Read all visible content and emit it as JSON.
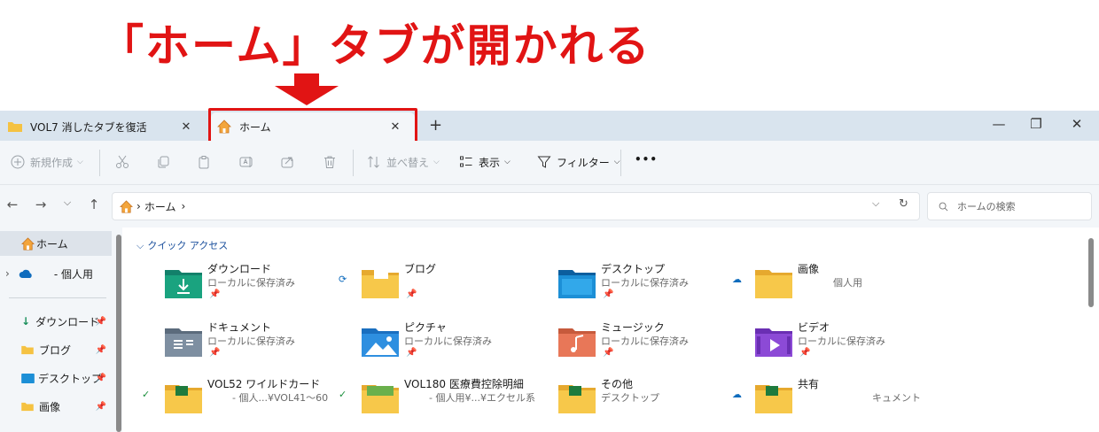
{
  "annotation": {
    "title": "「ホーム」タブが開かれる"
  },
  "tabs": {
    "inactive_label": "VOL7 消したタブを復活",
    "active_label": "ホーム",
    "close_glyph": "✕",
    "add_glyph": "+"
  },
  "window_controls": {
    "minimize": "—",
    "restore": "❐",
    "close": "✕"
  },
  "toolbar": {
    "new_label": "新規作成",
    "sort_label": "並べ替え",
    "view_label": "表示",
    "filter_label": "フィルター",
    "more_label": "•••"
  },
  "address": {
    "path_label": "ホーム",
    "search_placeholder": "ホームの検索"
  },
  "sidebar": {
    "items": [
      {
        "label": "ホーム"
      },
      {
        "label": "- 個人用"
      },
      {
        "label": "ダウンロード"
      },
      {
        "label": "ブログ"
      },
      {
        "label": "デスクトップ"
      },
      {
        "label": "画像"
      }
    ]
  },
  "quick_access": {
    "heading": "クイック アクセス",
    "tiles": [
      {
        "name": "ダウンロード",
        "sub": "ローカルに保存済み"
      },
      {
        "name": "ブログ",
        "sub": ""
      },
      {
        "name": "デスクトップ",
        "sub": "ローカルに保存済み"
      },
      {
        "name": "画像",
        "sub": "個人用"
      },
      {
        "name": "ドキュメント",
        "sub": "ローカルに保存済み"
      },
      {
        "name": "ピクチャ",
        "sub": "ローカルに保存済み"
      },
      {
        "name": "ミュージック",
        "sub": "ローカルに保存済み"
      },
      {
        "name": "ビデオ",
        "sub": "ローカルに保存済み"
      },
      {
        "name": "VOL52 ワイルドカード",
        "sub": "- 個人...¥VOL41～60"
      },
      {
        "name": "VOL180 医療費控除明細",
        "sub": "- 個人用¥...¥エクセル系"
      },
      {
        "name": "その他",
        "sub": "デスクトップ"
      },
      {
        "name": "共有",
        "sub": "キュメント"
      }
    ]
  },
  "colors": {
    "annotation_red": "#e11414",
    "tab_bar": "#d9e4ee",
    "folder_yellow": "#f5c242",
    "link_blue": "#1a4f9c"
  }
}
